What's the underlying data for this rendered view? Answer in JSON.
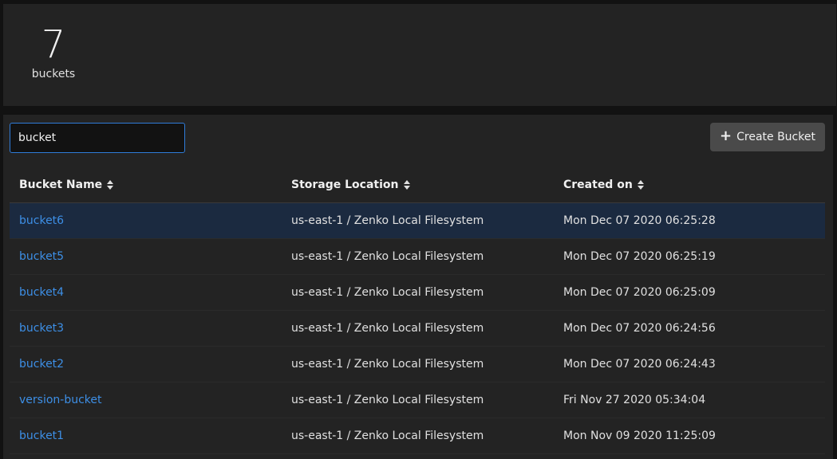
{
  "summary": {
    "count": "7",
    "label": "buckets"
  },
  "search": {
    "value": "bucket",
    "placeholder": ""
  },
  "toolbar": {
    "create_label": "Create Bucket",
    "icon": "plus-icon"
  },
  "table": {
    "headers": [
      "Bucket Name",
      "Storage Location",
      "Created on"
    ],
    "rows": [
      {
        "name": "bucket6",
        "location": "us-east-1 / Zenko Local Filesystem",
        "created": "Mon Dec 07 2020 06:25:28"
      },
      {
        "name": "bucket5",
        "location": "us-east-1 / Zenko Local Filesystem",
        "created": "Mon Dec 07 2020 06:25:19"
      },
      {
        "name": "bucket4",
        "location": "us-east-1 / Zenko Local Filesystem",
        "created": "Mon Dec 07 2020 06:25:09"
      },
      {
        "name": "bucket3",
        "location": "us-east-1 / Zenko Local Filesystem",
        "created": "Mon Dec 07 2020 06:24:56"
      },
      {
        "name": "bucket2",
        "location": "us-east-1 / Zenko Local Filesystem",
        "created": "Mon Dec 07 2020 06:24:43"
      },
      {
        "name": "version-bucket",
        "location": "us-east-1 / Zenko Local Filesystem",
        "created": "Fri Nov 27 2020 05:34:04"
      },
      {
        "name": "bucket1",
        "location": "us-east-1 / Zenko Local Filesystem",
        "created": "Mon Nov 09 2020 11:25:09"
      }
    ]
  },
  "colors": {
    "accent": "#2f7cd9",
    "link": "#3d8fe6",
    "selected_row": "#1b2a40"
  }
}
